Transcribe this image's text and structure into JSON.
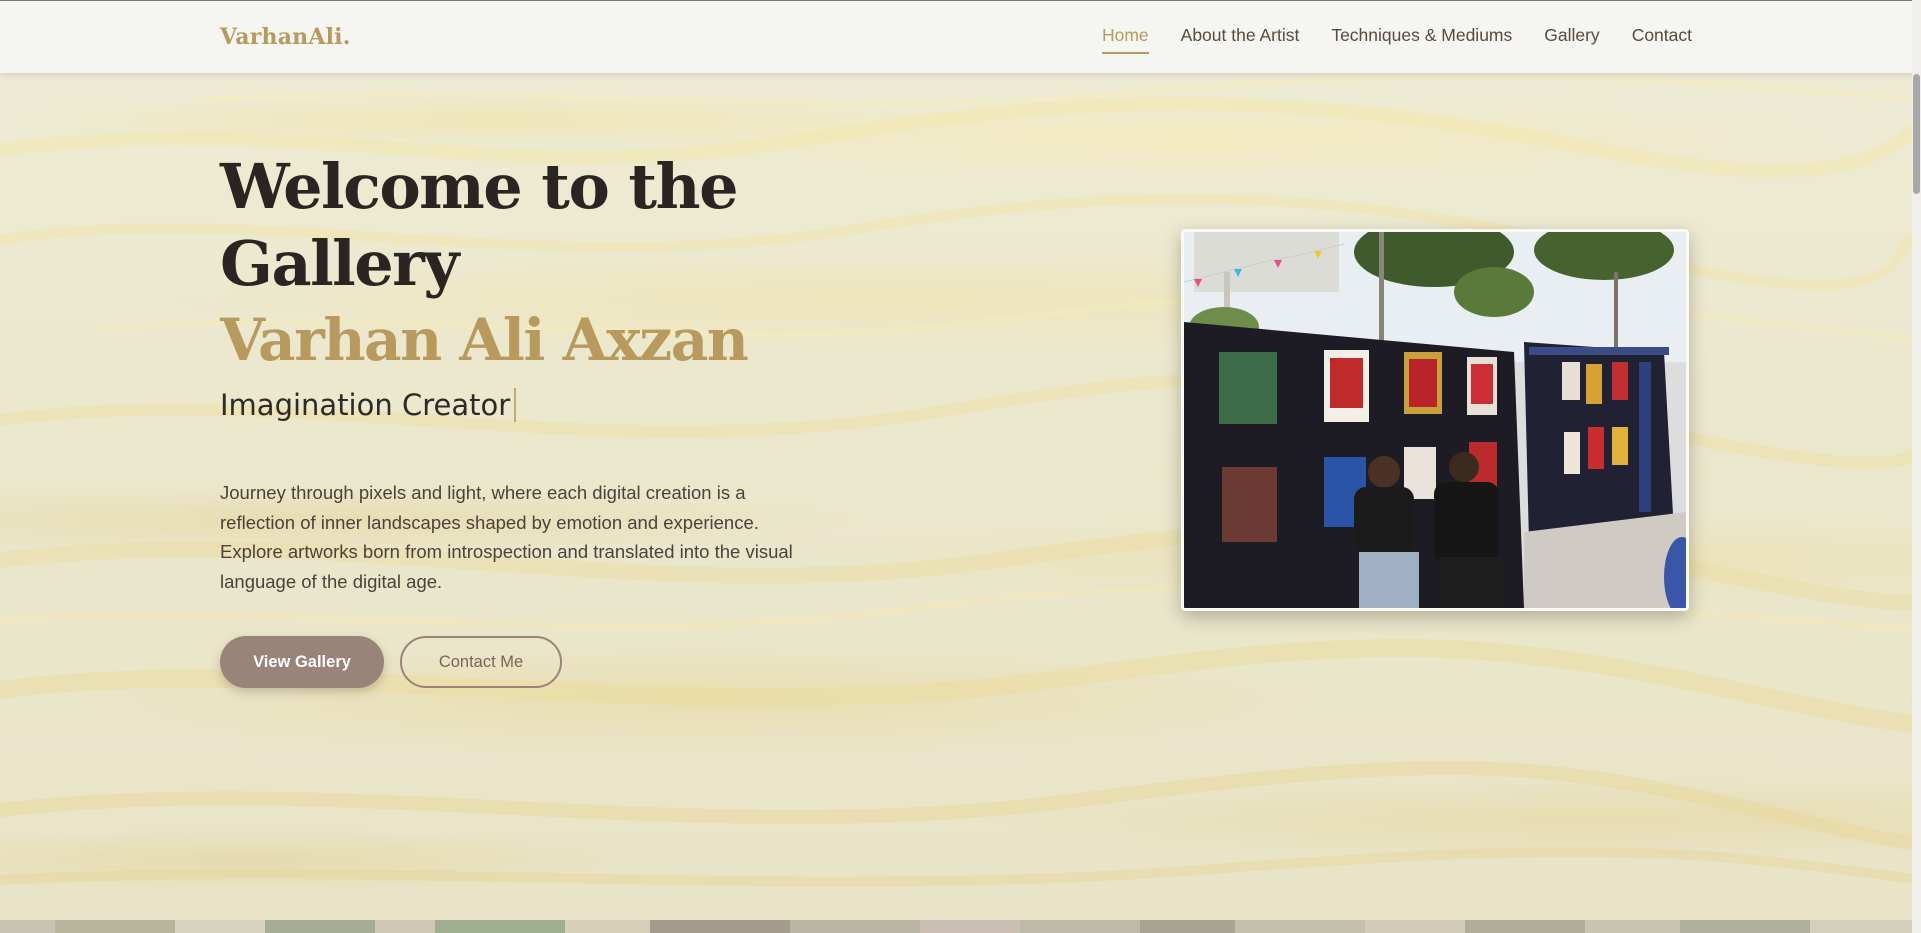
{
  "nav": {
    "logo": "VarhanAli.",
    "links": [
      {
        "label": "Home",
        "active": true
      },
      {
        "label": "About the Artist",
        "active": false
      },
      {
        "label": "Techniques & Mediums",
        "active": false
      },
      {
        "label": "Gallery",
        "active": false
      },
      {
        "label": "Contact",
        "active": false
      }
    ]
  },
  "hero": {
    "title_line1": "Welcome to the",
    "title_line2": "Gallery",
    "name": "Varhan Ali Axzan",
    "role": "Imagination Creator",
    "description": "Journey through pixels and light, where each digital creation is a reflection of inner landscapes shaped by emotion and experience. Explore artworks born from introspection and translated into the visual language of the digital age.",
    "primary_button": "View Gallery",
    "secondary_button": "Contact Me",
    "photo_alt": "Artist exhibition photo"
  },
  "colors": {
    "accent": "#b89a5e",
    "primary_button": "#9a8479",
    "text_dark": "#2a2521",
    "navbar": "#f5f5f2"
  },
  "icons": {
    "text_cursor": "typing-cursor-icon"
  }
}
